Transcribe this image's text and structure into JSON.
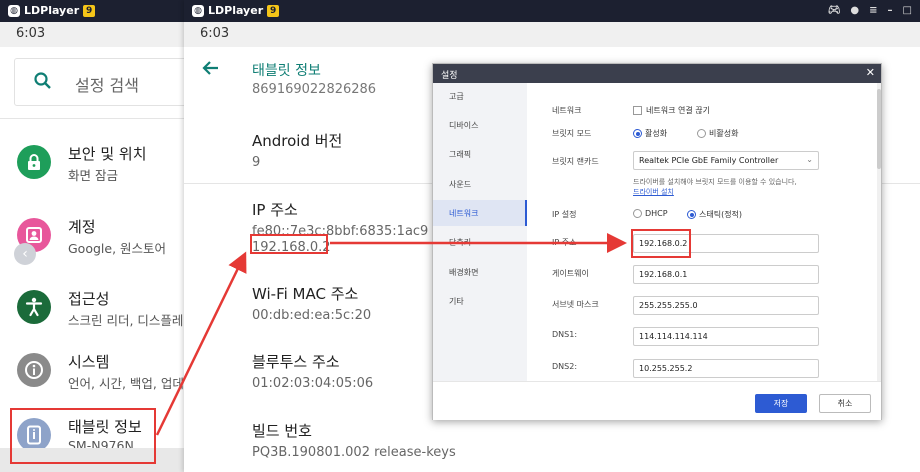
{
  "app": {
    "name": "LDPlayer",
    "badge": "9"
  },
  "status_time": "6:03",
  "left": {
    "search_placeholder": "설정 검색",
    "items": [
      {
        "title": "보안 및 위치",
        "sub": "화면 잠금",
        "color": "#1e9e5a",
        "icon": "lock-icon"
      },
      {
        "title": "계정",
        "sub": "Google, 원스토어",
        "color": "#e8579b",
        "icon": "account-icon"
      },
      {
        "title": "접근성",
        "sub": "스크린 리더, 디스플레",
        "color": "#1b6b3a",
        "icon": "accessibility-icon"
      },
      {
        "title": "시스템",
        "sub": "언어, 시간, 백업, 업데",
        "color": "#8a8a8a",
        "icon": "info-icon"
      },
      {
        "title": "태블릿 정보",
        "sub": "SM-N976N",
        "color": "#8ea3c9",
        "icon": "tablet-icon"
      }
    ]
  },
  "middle": {
    "page_title": "태블릿 정보",
    "cut_value": "869169022826286",
    "info": [
      {
        "key": "Android 버전",
        "vals": [
          "9"
        ]
      },
      {
        "key": "IP 주소",
        "vals": [
          "fe80::7e3c:8bbf:6835:1ac9",
          "192.168.0.2"
        ]
      },
      {
        "key": "Wi-Fi MAC 주소",
        "vals": [
          "00:db:ed:ea:5c:20"
        ]
      },
      {
        "key": "블루투스 주소",
        "vals": [
          "01:02:03:04:05:06"
        ]
      },
      {
        "key": "빌드 번호",
        "vals": [
          "PQ3B.190801.002 release-keys"
        ]
      }
    ]
  },
  "dialog": {
    "title": "설정",
    "nav": [
      "고급",
      "디바이스",
      "그래픽",
      "사운드",
      "네트워크",
      "단축키",
      "배경화면",
      "기타"
    ],
    "active_nav": "네트워크",
    "network_label": "네트워크",
    "network_checkbox": "네트워크 연결 끊기",
    "bridge_mode_label": "브릿지 모드",
    "bridge_on": "활성화",
    "bridge_off": "비활성화",
    "bridge_card_label": "브릿지 랜카드",
    "bridge_card_value": "Realtek PCIe GbE Family Controller",
    "driver_note": "드라이버를 설치해야 브릿지 모드를 이용할 수 있습니다,",
    "driver_link": "드라이버 설치",
    "ip_setting_label": "IP 설정",
    "ip_dhcp": "DHCP",
    "ip_static": "스태틱(정적)",
    "ip_label": "IP 주소",
    "ip_value": "192.168.0.2",
    "gateway_label": "게이트웨이",
    "gateway_value": "192.168.0.1",
    "subnet_label": "서브넷 마스크",
    "subnet_value": "255.255.255.0",
    "dns1_label": "DNS1:",
    "dns1_value": "114.114.114.114",
    "dns2_label": "DNS2:",
    "dns2_value": "10.255.255.2",
    "save": "저장",
    "cancel": "취소"
  },
  "accent_color": "#e53935"
}
